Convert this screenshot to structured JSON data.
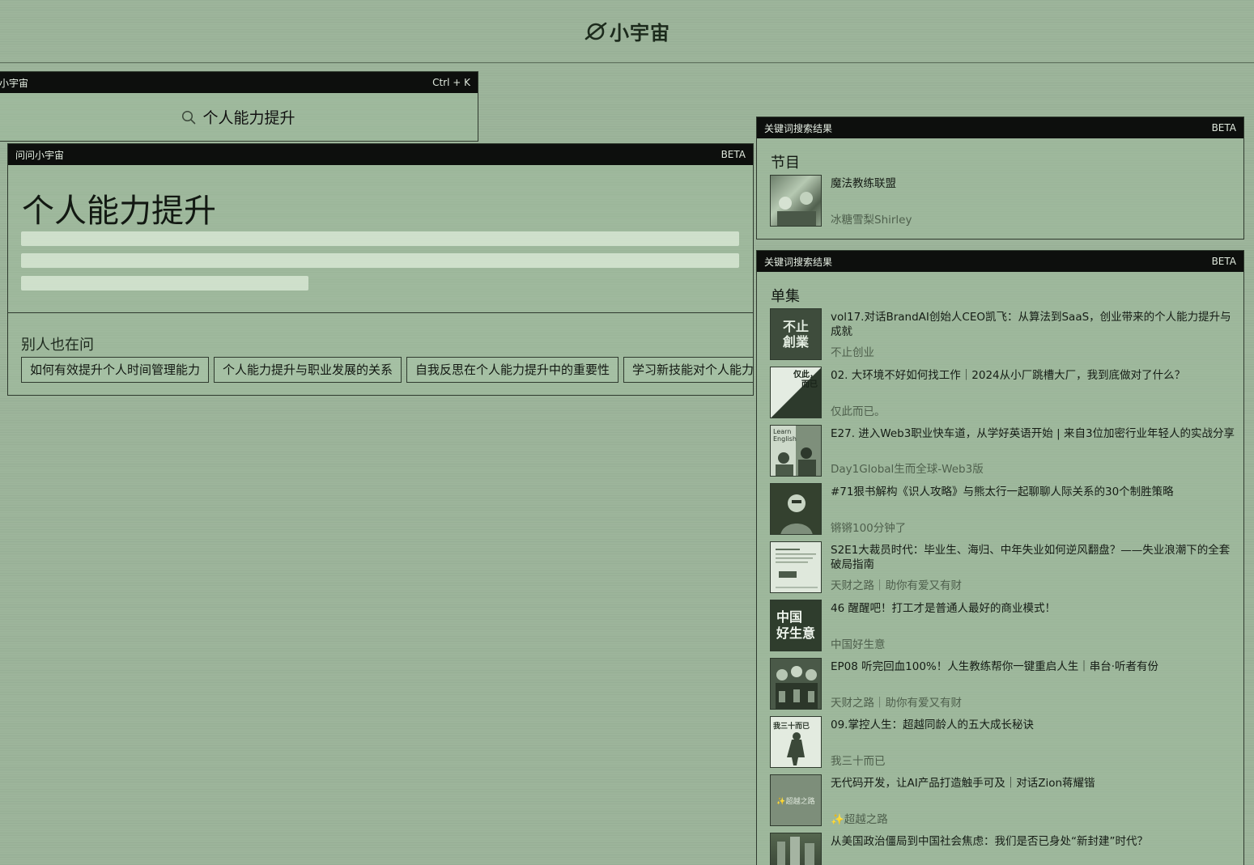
{
  "header": {
    "logo_text": "小宇宙"
  },
  "search": {
    "brand": "小宇宙",
    "shortcut": "Ctrl + K",
    "query": "个人能力提升"
  },
  "ask": {
    "header": "问问小宇宙",
    "badge": "BETA",
    "title": "个人能力提升",
    "also_ask_title": "别人也在问",
    "chips": [
      "如何有效提升个人时间管理能力",
      "个人能力提升与职业发展的关系",
      "自我反思在个人能力提升中的重要性",
      "学习新技能对个人能力提升的影响"
    ]
  },
  "podcasts": {
    "header": "关键词搜索结果",
    "badge": "BETA",
    "section_title": "节目",
    "items": [
      {
        "title": "魔法教练联盟",
        "author": "冰糖雪梨Shirley"
      }
    ]
  },
  "episodes": {
    "header": "关键词搜索结果",
    "badge": "BETA",
    "section_title": "单集",
    "items": [
      {
        "title": "vol17.对话BrandAI创始人CEO凯飞：从算法到SaaS，创业带来的个人能力提升与成就",
        "podcast": "不止创业",
        "thumb_text": "不止\n創業"
      },
      {
        "title": "02. 大环境不好如何找工作｜2024从小厂跳槽大厂，我到底做对了什么？",
        "podcast": "仅此而已。",
        "thumb_text": "仅此，\n而已"
      },
      {
        "title": "E27. 进入Web3职业快车道，从学好英语开始 | 来自3位加密行业年轻人的实战分享",
        "podcast": "Day1Global生而全球-Web3版",
        "thumb_text": "Learn\nEnglish"
      },
      {
        "title": "#71狠书解构《识人攻略》与熊太行一起聊聊人际关系的30个制胜策略",
        "podcast": "锵锵100分钟了",
        "thumb_text": ""
      },
      {
        "title": "S2E1大裁员时代：毕业生、海归、中年失业如何逆风翻盘？——失业浪潮下的全套破局指南",
        "podcast": "天财之路｜助你有爱又有财",
        "thumb_text": ""
      },
      {
        "title": "46 醒醒吧！打工才是普通人最好的商业模式！",
        "podcast": "中国好生意",
        "thumb_text": "中国\n好生意"
      },
      {
        "title": "EP08 听完回血100%！人生教练帮你一键重启人生｜串台·听者有份",
        "podcast": "天财之路｜助你有爱又有财",
        "thumb_text": ""
      },
      {
        "title": "09.掌控人生：超越同龄人的五大成长秘诀",
        "podcast": "我三十而已",
        "thumb_text": "我三十而已"
      },
      {
        "title": "无代码开发，让AI产品打造触手可及｜对话Zion蒋耀锴",
        "podcast": "✨超越之路",
        "thumb_text": "✨超越之路"
      },
      {
        "title": "从美国政治僵局到中国社会焦虑：我们是否已身处“新封建”时代？",
        "podcast": "",
        "thumb_text": ""
      }
    ]
  }
}
